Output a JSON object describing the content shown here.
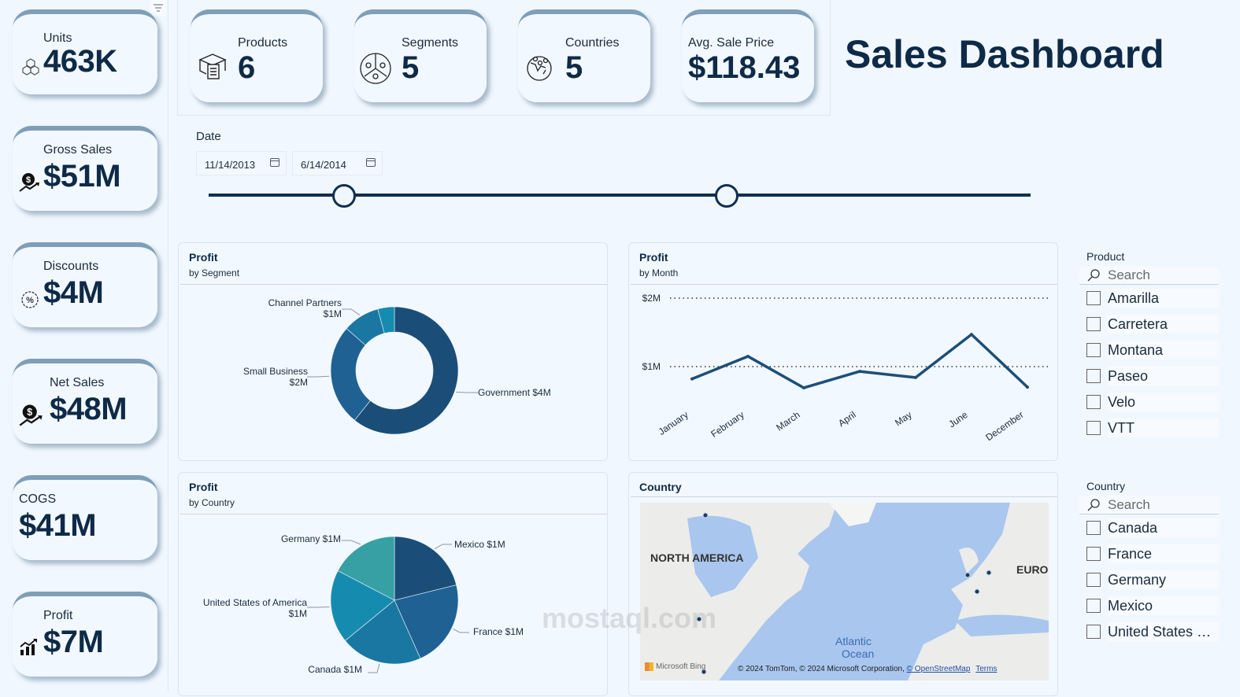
{
  "title": "Sales Dashboard",
  "kpis_left": [
    {
      "label": "Units",
      "value": "463K",
      "icon": "boxes-icon"
    },
    {
      "label": "Gross Sales",
      "value": "$51M",
      "icon": "money-growth-icon"
    },
    {
      "label": "Discounts",
      "value": "$4M",
      "icon": "discount-badge-icon"
    },
    {
      "label": "Net Sales",
      "value": "$48M",
      "icon": "money-growth-icon"
    },
    {
      "label": "COGS",
      "value": "$41M",
      "icon": ""
    },
    {
      "label": "Profit",
      "value": "$7M",
      "icon": "bar-growth-icon"
    }
  ],
  "kpis_top": [
    {
      "label": "Products",
      "value": "6",
      "icon": "product-box-icon"
    },
    {
      "label": "Segments",
      "value": "5",
      "icon": "segments-icon"
    },
    {
      "label": "Countries",
      "value": "5",
      "icon": "globe-pins-icon"
    },
    {
      "label": "Avg. Sale Price",
      "value": "$118.43",
      "icon": ""
    }
  ],
  "date_filter": {
    "label": "Date",
    "start": "11/14/2013",
    "end": "6/14/2014",
    "range_fraction": [
      0.165,
      0.63
    ]
  },
  "colors": {
    "primary": "#0e2a47",
    "series": [
      "#1a4e78",
      "#1f6193",
      "#1a77a2",
      "#168bb0",
      "#36a0a4"
    ],
    "line": "#1b4f7a"
  },
  "chart_data": [
    {
      "type": "pie",
      "variant": "donut",
      "title": "Profit",
      "subtitle": "by Segment",
      "slices": [
        {
          "name": "Government",
          "label": "Government $4M",
          "value": 3.9
        },
        {
          "name": "Small Business",
          "label": "Small Business|$2M",
          "value": 1.65
        },
        {
          "name": "Channel Partners",
          "label": "Channel Partners|$1M",
          "value": 0.6
        },
        {
          "name": "",
          "label": "",
          "value": 0.27
        }
      ]
    },
    {
      "type": "line",
      "title": "Profit",
      "subtitle": "by Month",
      "categories": [
        "January",
        "February",
        "March",
        "April",
        "May",
        "June",
        "December"
      ],
      "series": [
        {
          "name": "Profit",
          "values": [
            0.82,
            1.15,
            0.69,
            0.93,
            0.84,
            1.47,
            0.7
          ]
        }
      ],
      "yticks": [
        {
          "v": 1,
          "label": "$1M"
        },
        {
          "v": 2,
          "label": "$2M"
        }
      ],
      "ylim": [
        0,
        2
      ],
      "grid": true
    },
    {
      "type": "pie",
      "title": "Profit",
      "subtitle": "by Country",
      "slices": [
        {
          "name": "Mexico",
          "label": "Mexico $1M",
          "value": 1.0
        },
        {
          "name": "France",
          "label": "France $1M",
          "value": 1.05
        },
        {
          "name": "Canada",
          "label": "Canada $1M",
          "value": 0.98
        },
        {
          "name": "United States of America",
          "label": "United States of America|$1M",
          "value": 0.88
        },
        {
          "name": "Germany",
          "label": "Germany $1M",
          "value": 0.82
        }
      ]
    }
  ],
  "map": {
    "title": "Country",
    "labels": [
      "NORTH AMERICA",
      "EUROPE",
      "Atlantic",
      "Ocean"
    ],
    "brand": "Microsoft Bing",
    "attribution": "© 2024 TomTom, © 2024 Microsoft Corporation,",
    "osm_link": "© OpenStreetMap",
    "terms_link": "Terms"
  },
  "product_slicer": {
    "title": "Product",
    "search_placeholder": "Search",
    "items": [
      "Amarilla",
      "Carretera",
      "Montana",
      "Paseo",
      "Velo",
      "VTT"
    ]
  },
  "country_slicer": {
    "title": "Country",
    "search_placeholder": "Search",
    "items": [
      "Canada",
      "France",
      "Germany",
      "Mexico",
      "United States of America"
    ]
  },
  "watermark": "mostaql.com"
}
